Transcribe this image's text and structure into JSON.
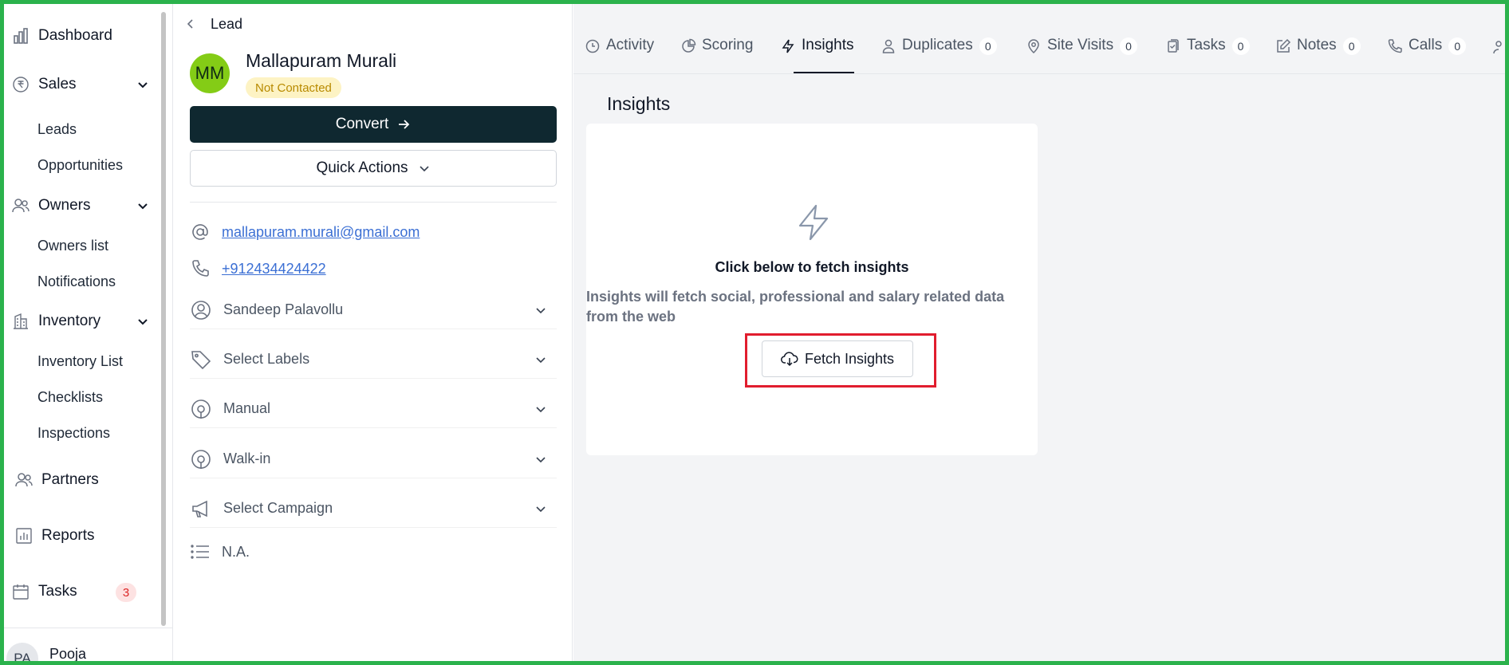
{
  "nav": {
    "items": {
      "dashboard": {
        "label": "Dashboard"
      },
      "sales": {
        "label": "Sales",
        "subitems": [
          "Leads",
          "Opportunities"
        ]
      },
      "owners": {
        "label": "Owners",
        "subitems": [
          "Owners list",
          "Notifications"
        ]
      },
      "inventory": {
        "label": "Inventory",
        "subitems": [
          "Inventory List",
          "Checklists",
          "Inspections"
        ]
      },
      "partners": {
        "label": "Partners"
      },
      "reports": {
        "label": "Reports"
      },
      "tasks": {
        "label": "Tasks",
        "badge": "3"
      }
    },
    "user": {
      "initials": "PA",
      "name": "Pooja"
    }
  },
  "lead": {
    "breadcrumb": "Lead",
    "avatar_initials": "MM",
    "name": "Mallapuram  Murali",
    "status": "Not Contacted",
    "convert_label": "Convert",
    "quick_actions_label": "Quick Actions",
    "email": "mallapuram.murali@gmail.com",
    "phone": "+912434424422",
    "fields": {
      "owner": "Sandeep Palavollu",
      "labels": "Select Labels",
      "source": "Manual",
      "subsource": "Walk-in",
      "campaign": "Select Campaign",
      "notes": "N.A."
    }
  },
  "tabs": {
    "activity": {
      "label": "Activity"
    },
    "scoring": {
      "label": "Scoring"
    },
    "insights": {
      "label": "Insights"
    },
    "duplicates": {
      "label": "Duplicates",
      "count": "0"
    },
    "site_visits": {
      "label": "Site Visits",
      "count": "0"
    },
    "tasks": {
      "label": "Tasks",
      "count": "0"
    },
    "notes": {
      "label": "Notes",
      "count": "0"
    },
    "calls": {
      "label": "Calls",
      "count": "0"
    },
    "active": "insights"
  },
  "insights": {
    "title": "Insights",
    "heading": "Click below to fetch insights",
    "description": "Insights will fetch social, professional and salary related data from the web",
    "button_label": "Fetch Insights"
  },
  "colors": {
    "frame": "#2bb24c",
    "highlight": "#e11d2e",
    "convert_bg": "#0f2830",
    "avatar_bg": "#84cc16",
    "link": "#3b6fd4",
    "status_bg": "#fdf3c4",
    "status_text": "#b88a00"
  }
}
